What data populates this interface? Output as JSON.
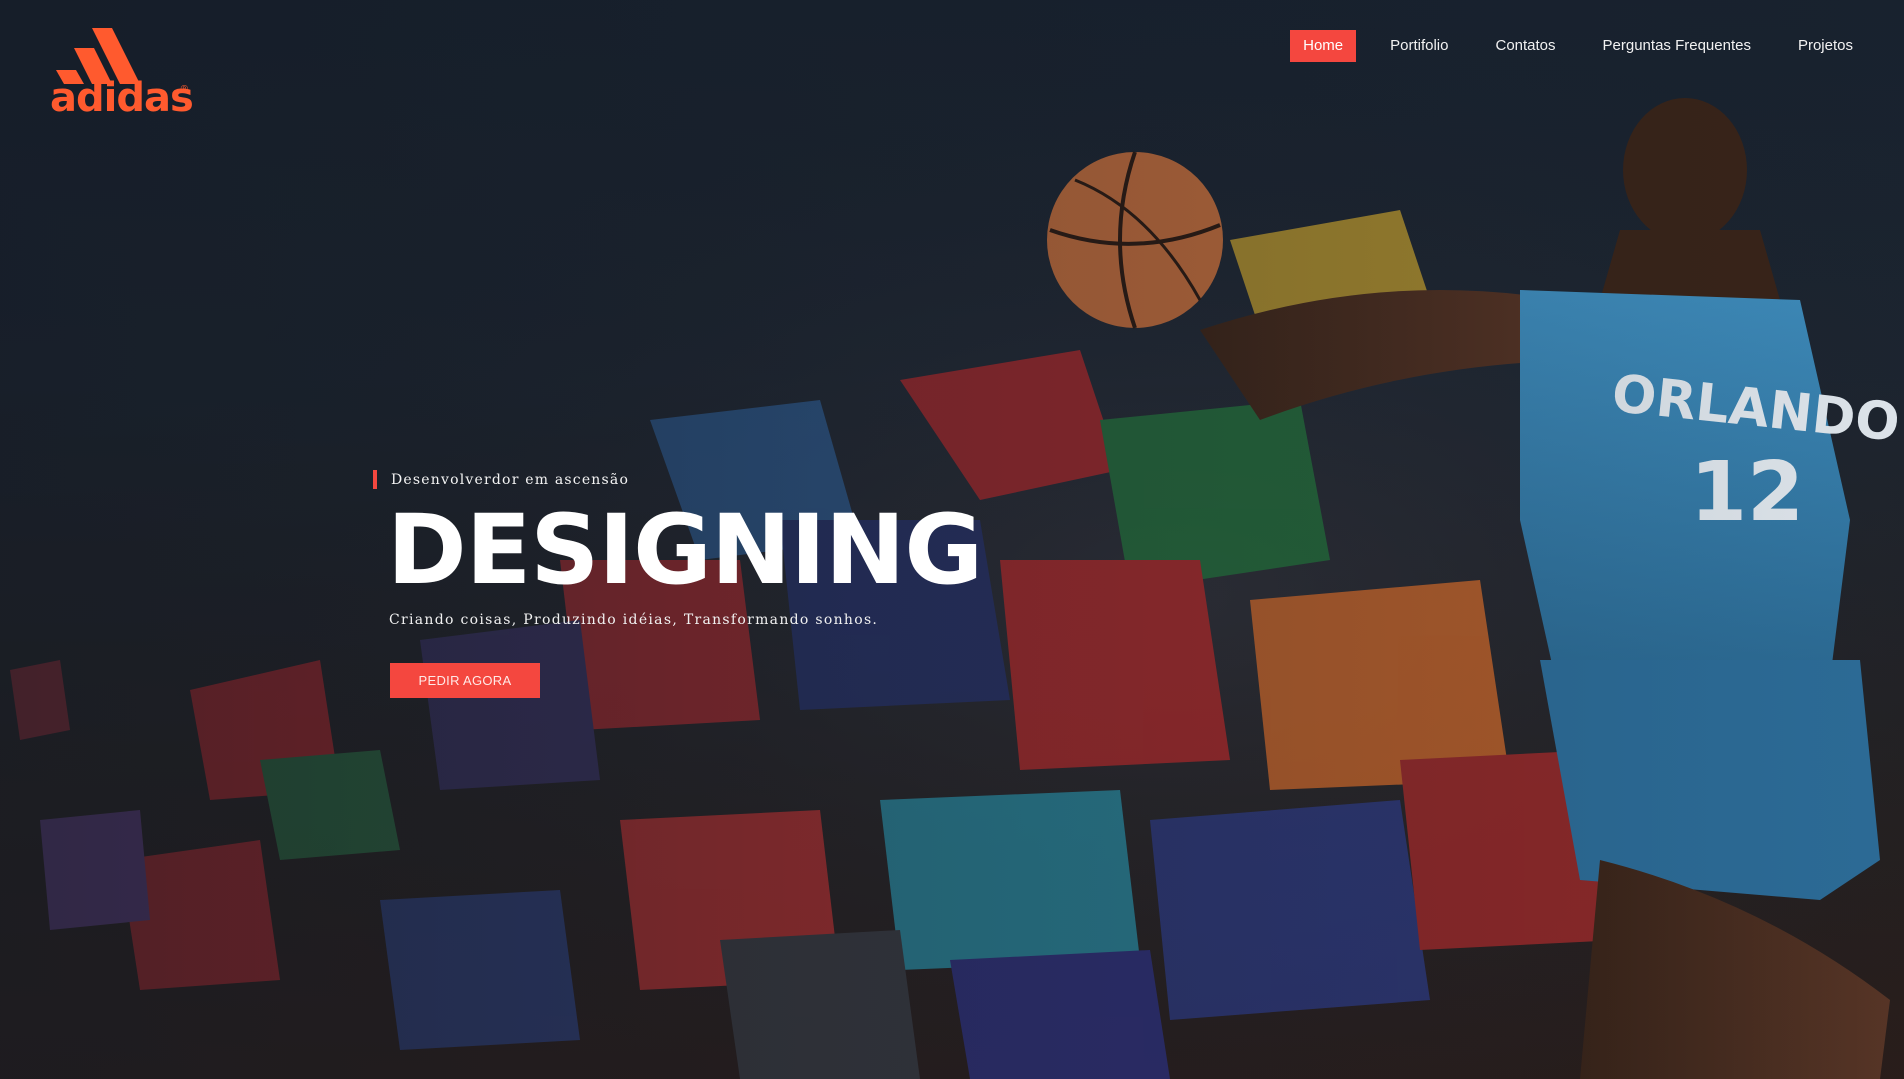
{
  "brand": {
    "name": "adidas",
    "logo_color": "#ff5a2e",
    "registered_mark": "®"
  },
  "nav": {
    "items": [
      {
        "label": "Home",
        "active": true
      },
      {
        "label": "Portifolio",
        "active": false
      },
      {
        "label": "Contatos",
        "active": false
      },
      {
        "label": "Perguntas Frequentes",
        "active": false
      },
      {
        "label": "Projetos",
        "active": false
      }
    ],
    "active_color": "#f4473f"
  },
  "hero": {
    "eyebrow": "Desenvolverdor em ascensão",
    "headline": "DESIGNING",
    "subline": "Criando coisas, Produzindo idéias, Transformando sonhos.",
    "cta_label": "PEDIR AGORA",
    "accent_color": "#f4473f",
    "player_jersey_team": "ORLANDO",
    "player_jersey_number": "12"
  }
}
